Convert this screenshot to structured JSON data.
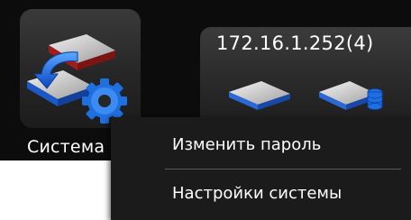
{
  "taskbar": {
    "app": {
      "label": "Система",
      "icon": "system-settings-icon"
    },
    "server": {
      "title": "172.16.1.252(4)",
      "icons": [
        "disk-icon",
        "disk-database-icon"
      ]
    }
  },
  "context_menu": {
    "items": [
      {
        "label": "Изменить пароль"
      },
      {
        "label": "Настройки системы"
      }
    ]
  },
  "colors": {
    "background": "#0c0c0c",
    "menu_background": "#1b1b1b",
    "accent_blue": "#1e6fe0",
    "text": "#ffffff"
  }
}
